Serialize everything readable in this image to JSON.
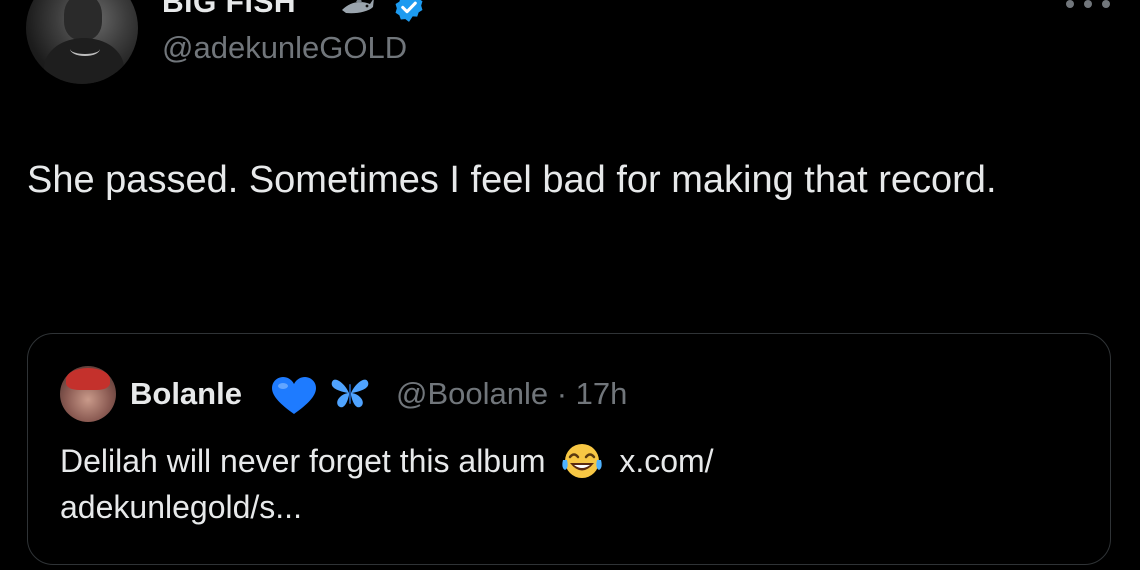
{
  "author": {
    "display_name": "BIG FISH",
    "handle": "@adekunleGOLD",
    "name_emoji_icon": "shark-icon",
    "verified_icon": "verified-badge-icon"
  },
  "tweet": {
    "text": "She passed. Sometimes I feel bad for making that record."
  },
  "quoted_tweet": {
    "display_name": "Bolanle",
    "name_emojis": [
      "blue-heart-icon",
      "butterfly-icon"
    ],
    "handle_and_time": "@Boolanle · 17h",
    "text_before_emoji": "Delilah will never forget this album",
    "emoji": "tears-of-joy-icon",
    "link_text": "x.com/",
    "link_text_line2": "adekunlegold/s..."
  },
  "colors": {
    "background": "#000000",
    "primary_text": "#e7e9ea",
    "secondary_text": "#71767b",
    "verified_blue": "#1d9bf0",
    "border": "#2f3336"
  }
}
